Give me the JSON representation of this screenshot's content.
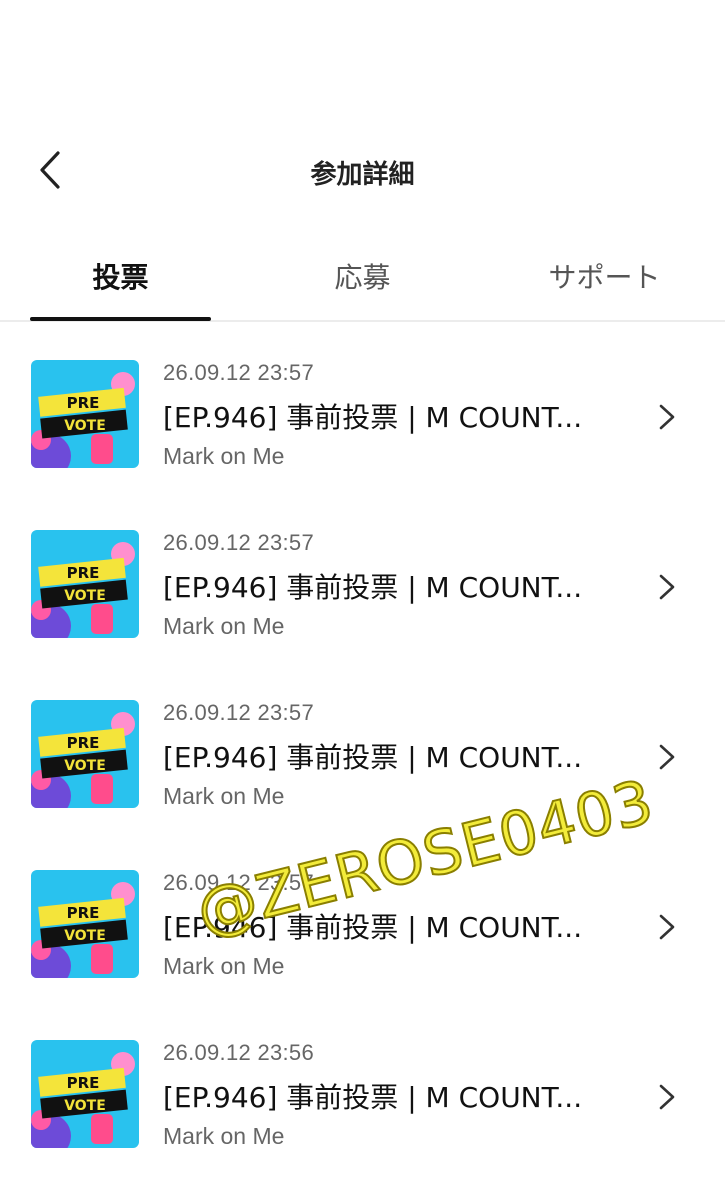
{
  "header": {
    "title": "参加詳細"
  },
  "tabs": [
    {
      "label": "投票"
    },
    {
      "label": "応募"
    },
    {
      "label": "サポート"
    }
  ],
  "thumb": {
    "line1": "PRE",
    "line2": "VOTE"
  },
  "items": [
    {
      "date": "26.09.12 23:57",
      "title": "[EP.946] 事前投票 | M COUNT...",
      "artist": "Mark on Me"
    },
    {
      "date": "26.09.12 23:57",
      "title": "[EP.946] 事前投票 | M COUNT...",
      "artist": "Mark on Me"
    },
    {
      "date": "26.09.12 23:57",
      "title": "[EP.946] 事前投票 | M COUNT...",
      "artist": "Mark on Me"
    },
    {
      "date": "26.09.12 23:57",
      "title": "[EP.946] 事前投票 | M COUNT...",
      "artist": "Mark on Me"
    },
    {
      "date": "26.09.12 23:56",
      "title": "[EP.946] 事前投票 | M COUNT...",
      "artist": "Mark on Me"
    }
  ],
  "watermark": "@ZEROSE0403"
}
